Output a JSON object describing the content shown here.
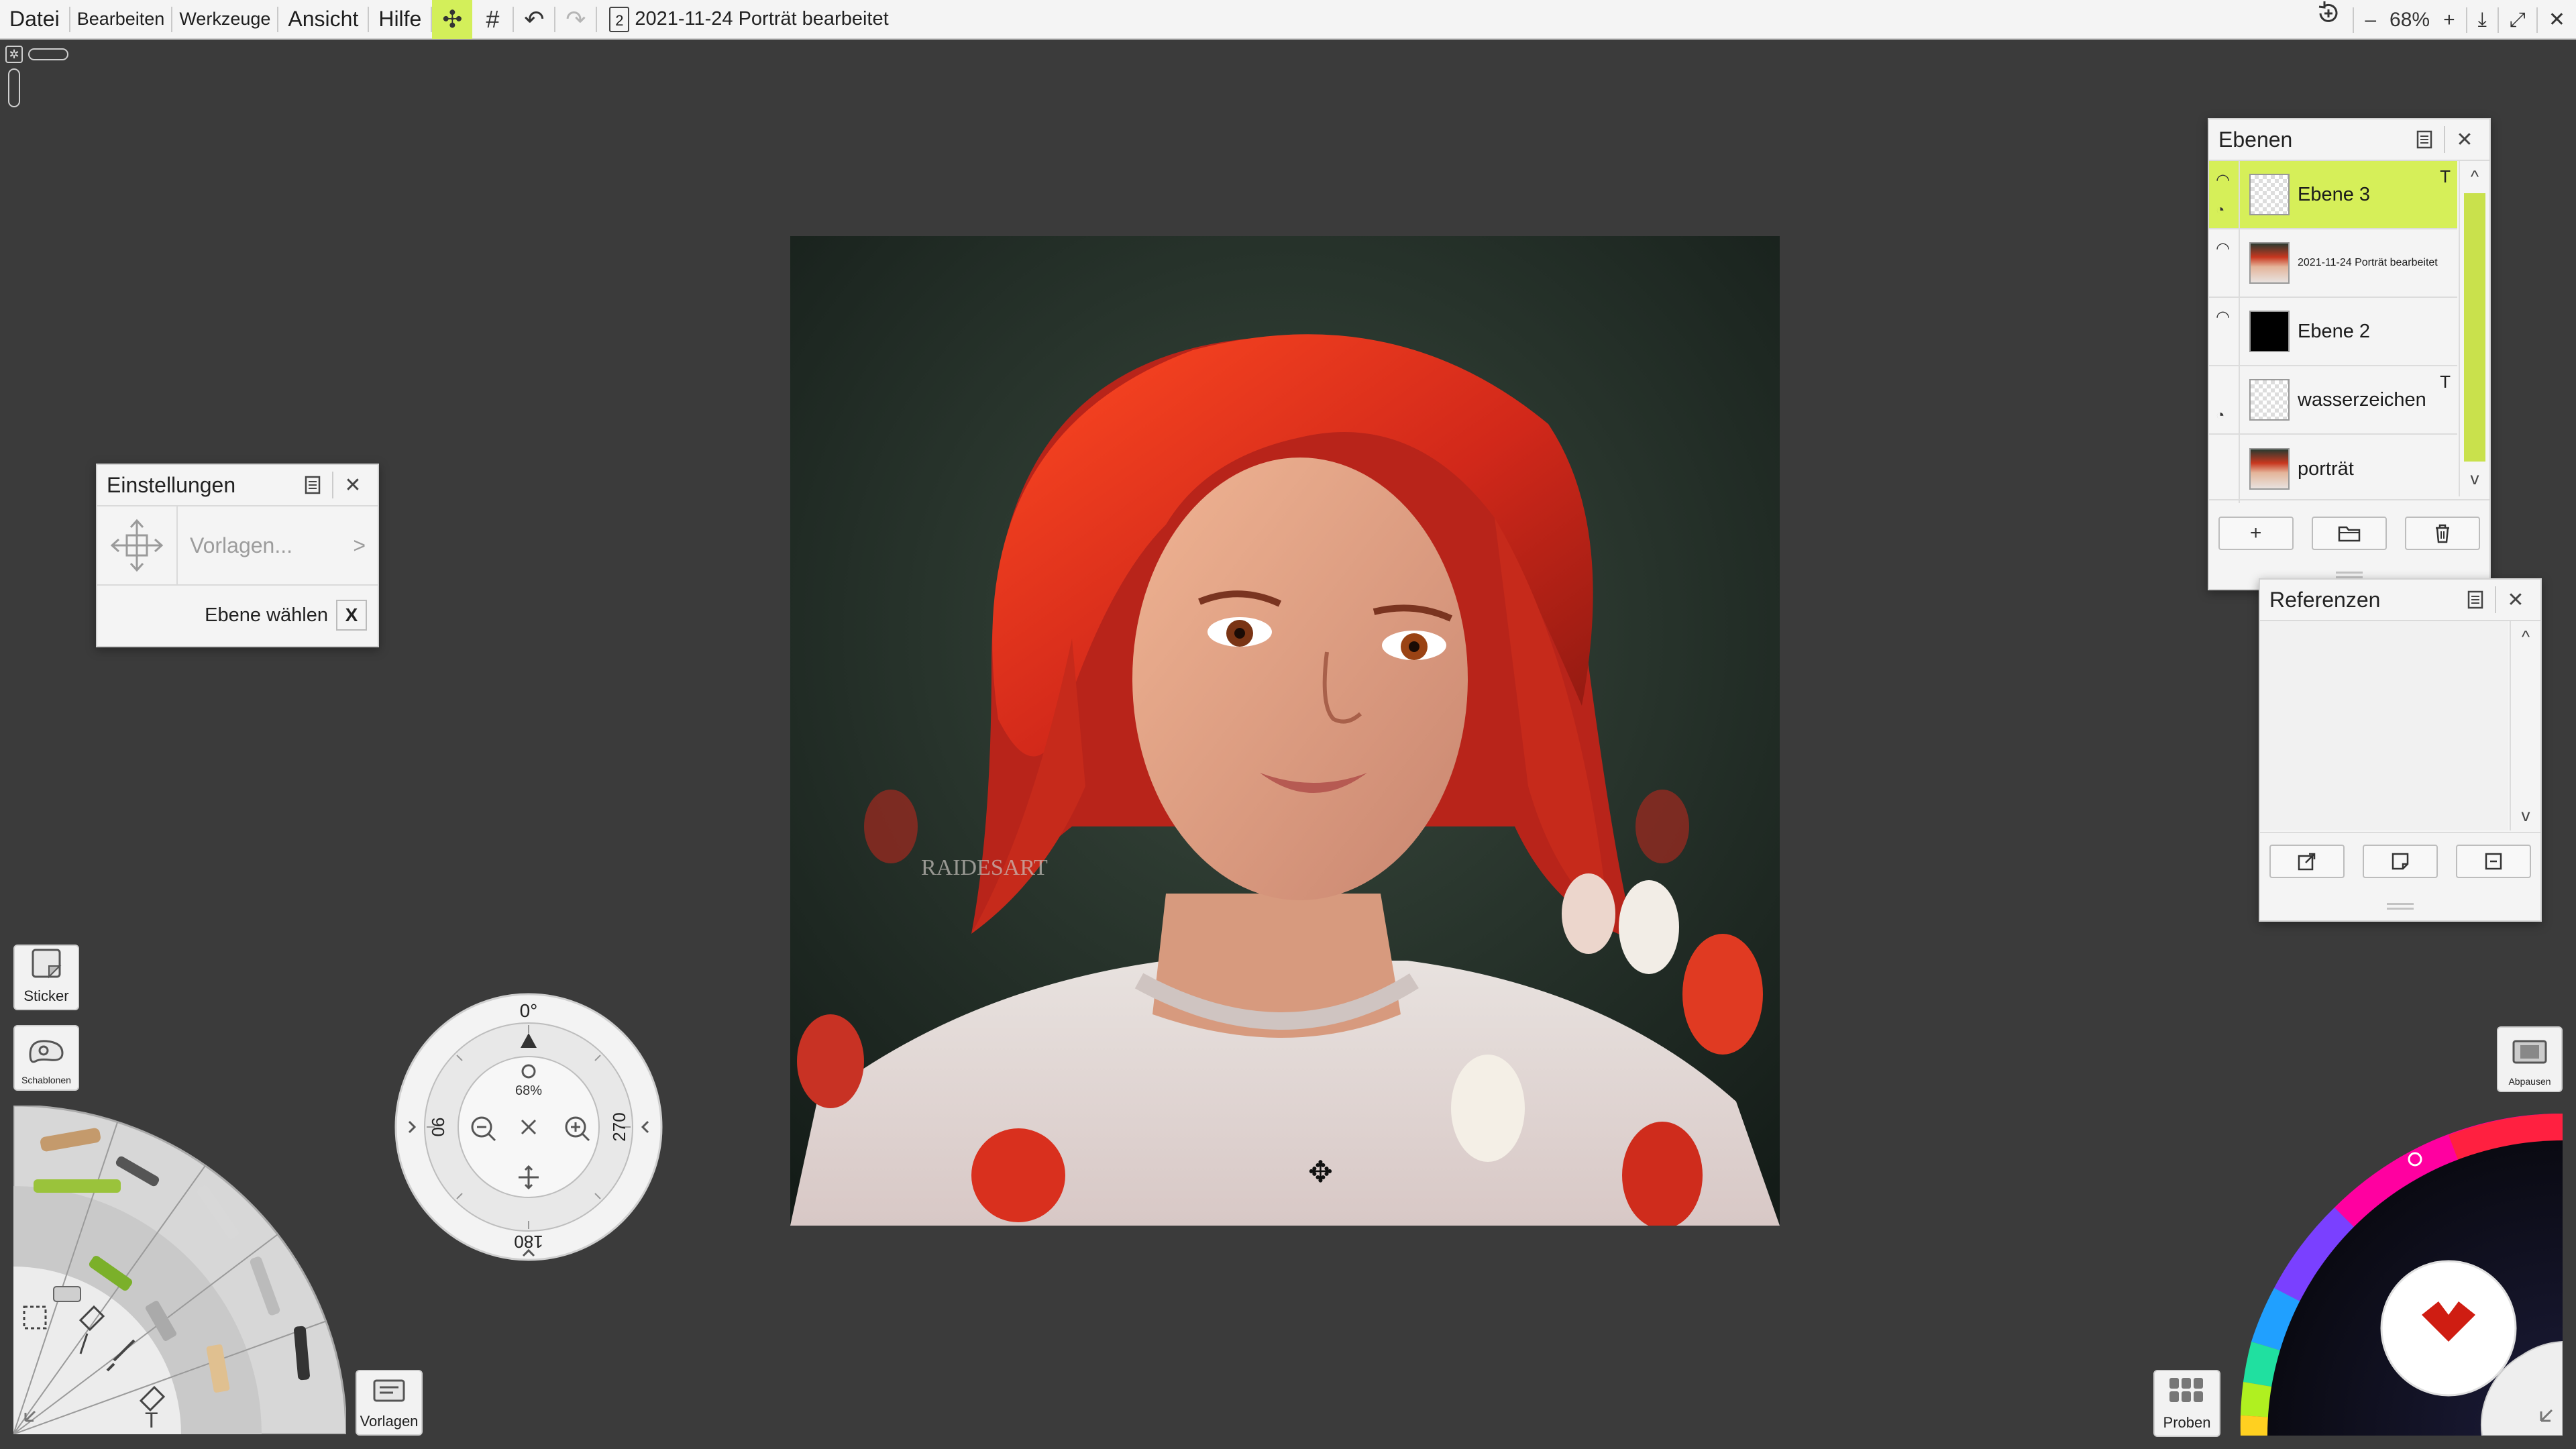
{
  "menu": {
    "datei": "Datei",
    "bearbeiten": "Bearbeiten",
    "werkzeuge": "Werkzeuge",
    "ansicht": "Ansicht",
    "hilfe": "Hilfe"
  },
  "toolbar": {
    "move_icon": "✣",
    "grid_icon": "#",
    "undo_icon": "↶",
    "redo_icon": "↷",
    "doc_number": "2",
    "document_title": "2021-11-24 Porträt bearbeitet"
  },
  "topbar_right": {
    "zoom_out": "–",
    "zoom_level": "68%",
    "zoom_in": "+",
    "download_icon": "⤓",
    "fullscreen_icon": "⤢",
    "close_icon": "✕"
  },
  "einstellungen": {
    "title": "Einstellungen",
    "vorlagen": "Vorlagen...",
    "chevron": ">",
    "ebene_waehlen": "Ebene wählen",
    "x_label": "X"
  },
  "ebenen": {
    "title": "Ebenen",
    "layers": [
      {
        "name": "Ebene 3",
        "t": "T",
        "selected": true
      },
      {
        "name": "2021-11-24 Porträt bearbeitet",
        "t": "",
        "selected": false
      },
      {
        "name": "Ebene 2",
        "t": "",
        "selected": false
      },
      {
        "name": "wasserzeichen",
        "t": "T",
        "selected": false
      },
      {
        "name": "porträt",
        "t": "",
        "selected": false
      }
    ],
    "add": "+",
    "scroll_up": "^",
    "scroll_down": "v"
  },
  "referenzen": {
    "title": "Referenzen",
    "scroll_up": "^",
    "scroll_down": "v"
  },
  "tools": {
    "sticker": "Sticker",
    "schablonen": "Schablonen",
    "vorlagen": "Vorlagen",
    "proben": "Proben",
    "abpausen": "Abpausen"
  },
  "puck": {
    "angle_top": "0°",
    "angle_left": "90",
    "angle_right": "270",
    "angle_bottom": "180",
    "zoom": "68%"
  },
  "canvas": {
    "watermark": "RAIDESART"
  },
  "colors": {
    "accent": "#d6ef59",
    "background": "#3b3b3b",
    "panel": "#f4f4f4"
  }
}
